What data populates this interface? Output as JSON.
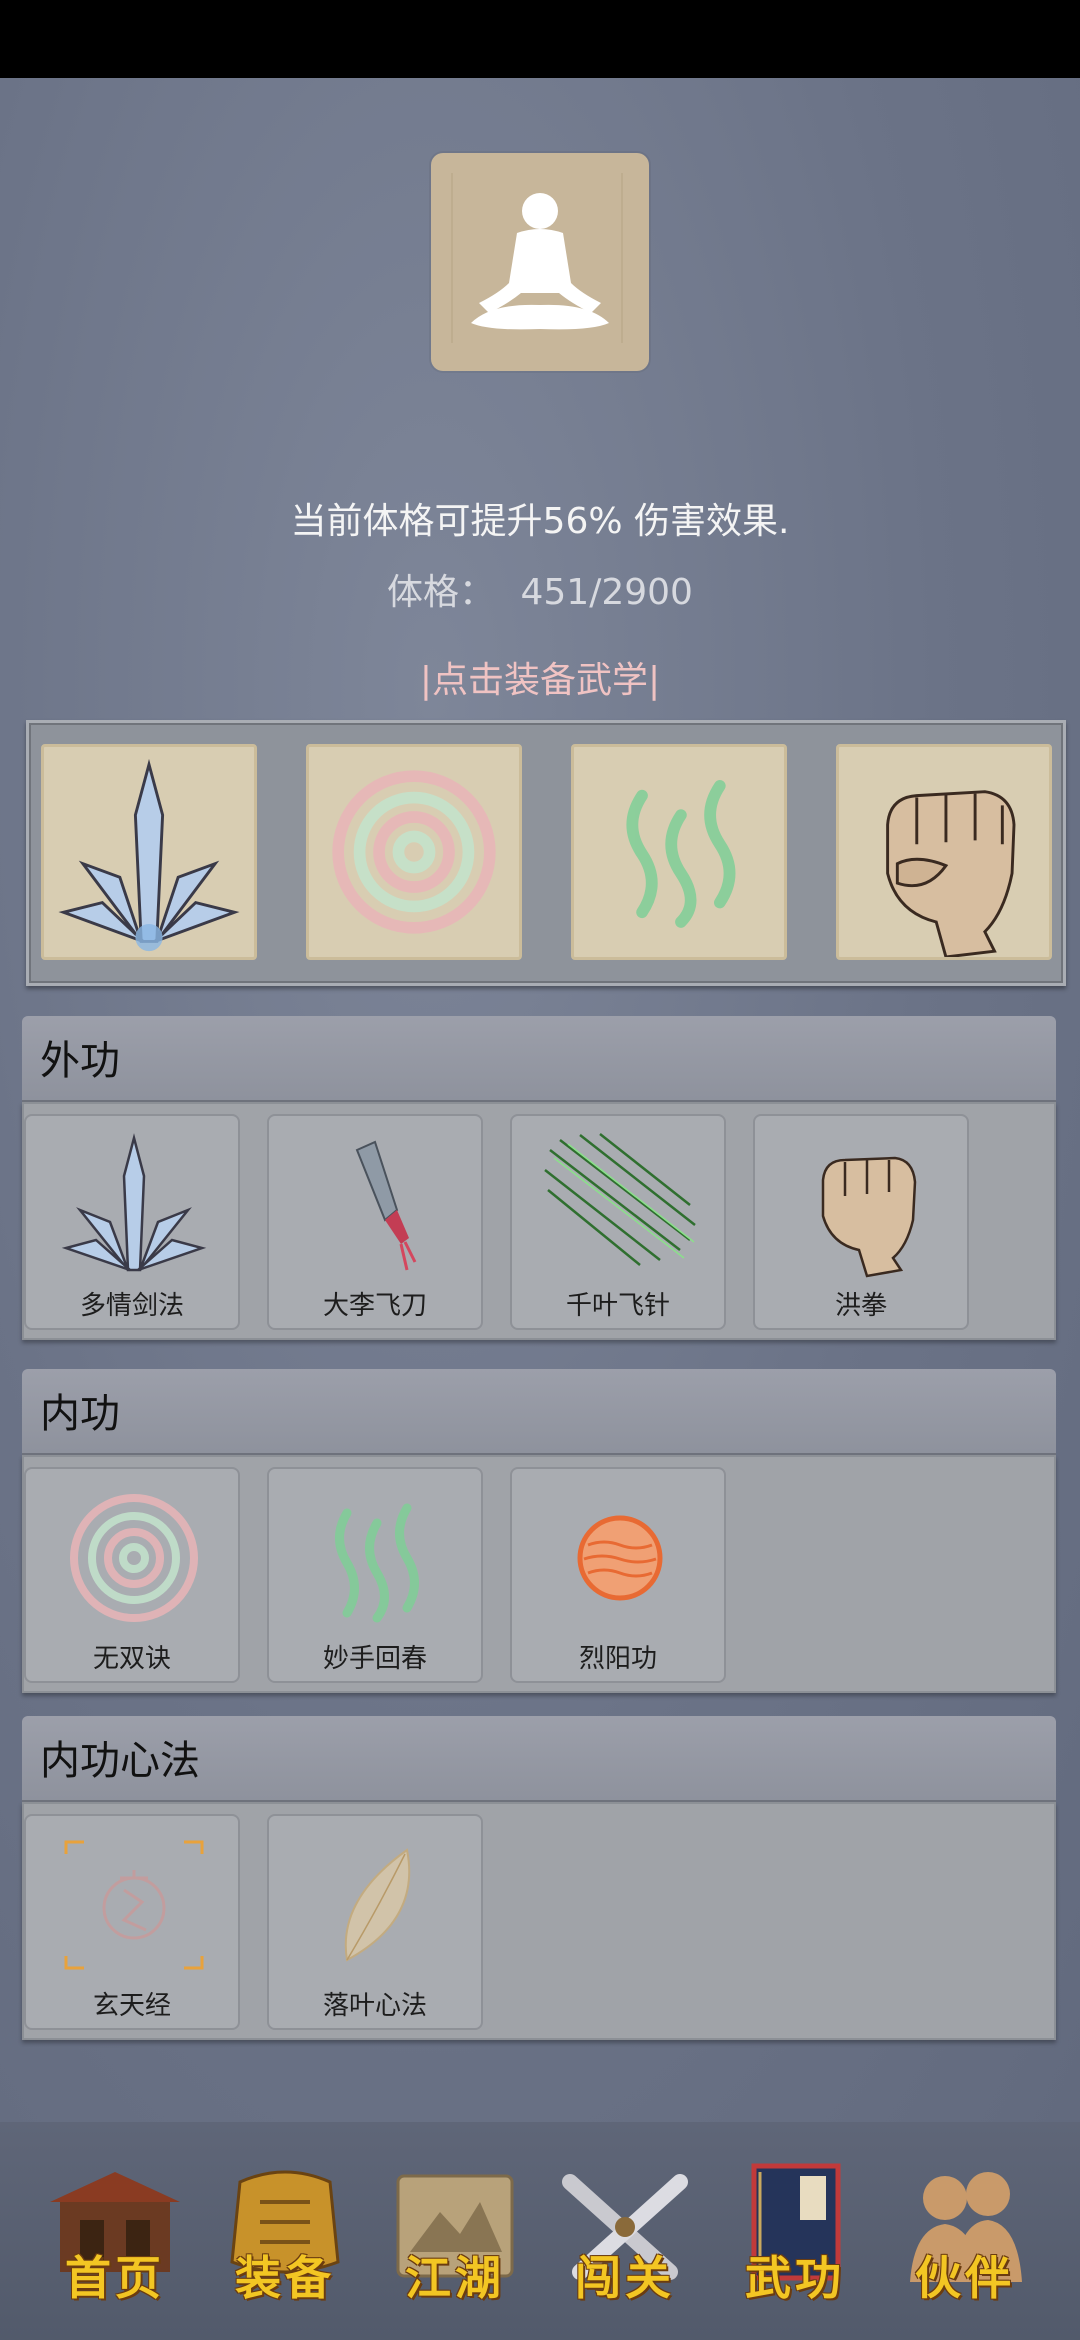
{
  "header": {
    "bonus_text": "当前体格可提升56% 伤害效果.",
    "physique_label": "体格：",
    "physique_value": "451/2900",
    "equip_link": "|点击装备武学|"
  },
  "equipped": [
    {
      "icon": "ice-sword-icon"
    },
    {
      "icon": "spiral-energy-icon"
    },
    {
      "icon": "green-waves-icon"
    },
    {
      "icon": "fist-icon"
    }
  ],
  "sections": {
    "external": {
      "title": "外功",
      "skills": [
        {
          "label": "多情剑法",
          "icon": "ice-sword-icon"
        },
        {
          "label": "大李飞刀",
          "icon": "flying-knife-icon"
        },
        {
          "label": "千叶飞针",
          "icon": "needles-icon"
        },
        {
          "label": "洪拳",
          "icon": "fist-icon"
        }
      ]
    },
    "internal": {
      "title": "内功",
      "skills": [
        {
          "label": "无双诀",
          "icon": "spiral-energy-icon"
        },
        {
          "label": "妙手回春",
          "icon": "green-waves-icon"
        },
        {
          "label": "烈阳功",
          "icon": "sun-orb-icon"
        }
      ]
    },
    "mind": {
      "title": "内功心法",
      "skills": [
        {
          "label": "玄天经",
          "icon": "xuan-scroll-icon"
        },
        {
          "label": "落叶心法",
          "icon": "leaf-icon"
        }
      ]
    }
  },
  "nav": [
    {
      "label": "首页",
      "icon": "house-icon"
    },
    {
      "label": "装备",
      "icon": "armor-icon"
    },
    {
      "label": "江湖",
      "icon": "scroll-map-icon"
    },
    {
      "label": "闯关",
      "icon": "crossed-swords-icon"
    },
    {
      "label": "武功",
      "icon": "martial-book-icon"
    },
    {
      "label": "伙伴",
      "icon": "companions-icon"
    }
  ],
  "colors": {
    "background": "#6b7387",
    "nav_label": "#f3c623",
    "equip_link": "#f0c3c3"
  }
}
